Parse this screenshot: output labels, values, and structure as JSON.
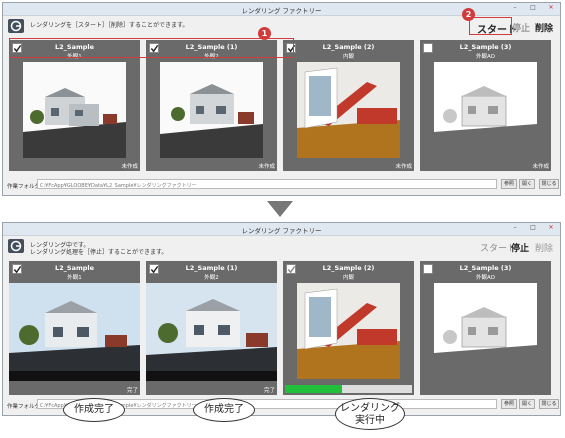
{
  "window1": {
    "title": "レンダリング ファクトリー",
    "message": "レンダリングを［スタート］［削除］することができます。",
    "toolbar": {
      "start": "スタート",
      "stop": "停止",
      "delete": "削除"
    },
    "cards": [
      {
        "name": "L2_Sample",
        "view": "外観1",
        "status": "未作成",
        "checked": true
      },
      {
        "name": "L2_Sample (1)",
        "view": "外観2",
        "status": "未作成",
        "checked": true
      },
      {
        "name": "L2_Sample (2)",
        "view": "内観",
        "status": "未作成",
        "checked": true
      },
      {
        "name": "L2_Sample (3)",
        "view": "外観AO",
        "status": "未作成",
        "checked": false
      }
    ],
    "footer": {
      "label": "作業フォルダ",
      "path": "C:¥FcApp¥GLOOBE¥Data¥L2_Sample¥レンダリングファクトリー",
      "ref": "参照",
      "open": "開く",
      "close": "閉じる"
    },
    "badges": [
      "1",
      "2"
    ]
  },
  "window2": {
    "title": "レンダリング ファクトリー",
    "message_line1": "レンダリング中です。",
    "message_line2": "レンダリング処理を［停止］することができます。",
    "toolbar": {
      "start": "スタート",
      "stop": "停止",
      "delete": "削除"
    },
    "cards": [
      {
        "name": "L2_Sample",
        "view": "外観1",
        "status": "完了",
        "checked": true
      },
      {
        "name": "L2_Sample (1)",
        "view": "外観2",
        "status": "完了",
        "checked": true
      },
      {
        "name": "L2_Sample (2)",
        "view": "内観",
        "status": "",
        "checked": true,
        "progress": 0.45
      },
      {
        "name": "L2_Sample (3)",
        "view": "外観AO",
        "status": "",
        "checked": false
      }
    ],
    "footer": {
      "label": "作業フォルダ",
      "path": "C:¥FcApp¥GLOOBE¥Data¥L2_Sample¥レンダリングファクトリー",
      "ref": "参照",
      "open": "開く",
      "close": "閉じる"
    }
  },
  "callouts": {
    "done1": "作成完了",
    "done2": "作成完了",
    "rendering": "レンダリング実行中"
  },
  "colors": {
    "highlight": "#d23b3b",
    "progress": "#22c03a",
    "card_bg": "#6a6a6a"
  }
}
